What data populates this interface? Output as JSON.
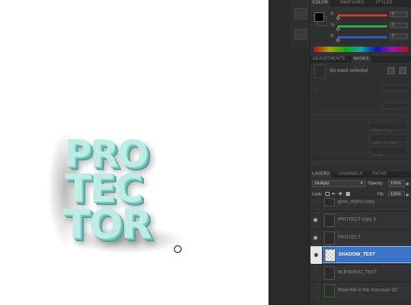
{
  "artwork": {
    "line1": "PRO",
    "line2": "TEC",
    "line3": "TOR"
  },
  "color_panel": {
    "tabs": [
      "COLOR",
      "SWATCHES",
      "STYLES"
    ],
    "sliders": [
      {
        "label": "R",
        "value": "0",
        "color": "#d43a3a"
      },
      {
        "label": "G",
        "value": "0",
        "color": "#2fb24a"
      },
      {
        "label": "B",
        "value": "0",
        "color": "#2f5fd4"
      }
    ]
  },
  "masks_panel": {
    "tabs": [
      "ADJUSTMENTS",
      "MASKS"
    ],
    "status": "No mask selected",
    "buttons": [
      "Mask Edge...",
      "Color Range...",
      "Invert"
    ]
  },
  "layers_panel": {
    "tabs": [
      "LAYERS",
      "CHANNELS",
      "PATHS"
    ],
    "blend_mode": "Multiply",
    "opacity_label": "Opacity:",
    "opacity_value": "100%",
    "lock_label": "Lock:",
    "fill_label": "Fill:",
    "fill_value": "100%",
    "layers": [
      {
        "name": "glow_object copy",
        "visible": false,
        "active": false
      },
      {
        "name": "PROTECT copy 2",
        "visible": true,
        "active": false
      },
      {
        "name": "PROTECT",
        "visible": true,
        "active": false
      },
      {
        "name": "SHADOW_TEXT",
        "visible": true,
        "active": true
      },
      {
        "name": "BLENDING_TEXT",
        "visible": false,
        "active": false
      },
      {
        "name": "Waterfall in the mountain 02",
        "visible": false,
        "active": false
      }
    ]
  }
}
